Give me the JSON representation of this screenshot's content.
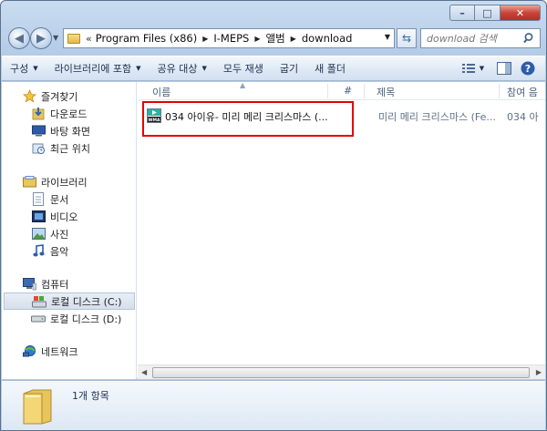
{
  "window": {
    "caption": {
      "minimize": "–",
      "maximize": "□",
      "close": "✕"
    }
  },
  "address": {
    "crumbs": [
      "Program Files (x86)",
      "I-MEPS",
      "앨범",
      "download"
    ]
  },
  "search": {
    "placeholder": "download 검색"
  },
  "toolbar": {
    "organize": "구성",
    "include_library": "라이브러리에 포함",
    "share": "공유 대상",
    "play_all": "모두 재생",
    "burn": "굽기",
    "new_folder": "새 폴더"
  },
  "nav": {
    "favorites": {
      "label": "즐겨찾기",
      "items": [
        "다운로드",
        "바탕 화면",
        "최근 위치"
      ]
    },
    "libraries": {
      "label": "라이브러리",
      "items": [
        "문서",
        "비디오",
        "사진",
        "음악"
      ]
    },
    "computer": {
      "label": "컴퓨터",
      "items": [
        "로컬 디스크 (C:)",
        "로컬 디스크 (D:)"
      ]
    },
    "network": {
      "label": "네트워크"
    }
  },
  "columns": {
    "name": "이름",
    "number": "#",
    "title": "제목",
    "artist": "참여 음"
  },
  "files": [
    {
      "name": "034 아이유- 미리 메리 크리스마스 (...",
      "title": "미리 메리 크리스마스 (Fe...",
      "artist": "034 아"
    }
  ],
  "status": {
    "count": "1개 항목"
  },
  "colors": {
    "highlight": "#e60000",
    "accent": "#3a6aa8"
  }
}
